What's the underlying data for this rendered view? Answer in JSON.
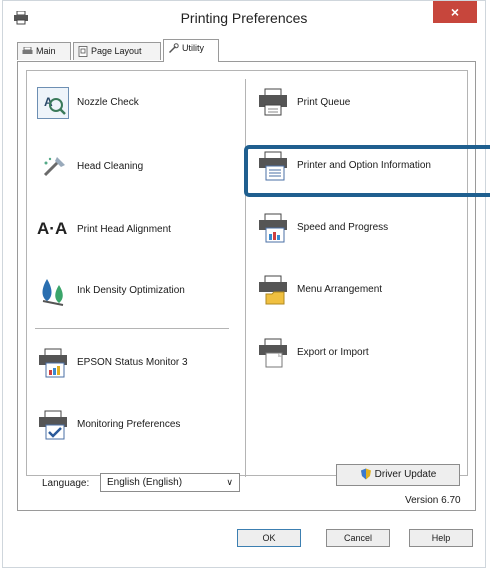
{
  "window": {
    "title": "Printing Preferences",
    "close_glyph": "×"
  },
  "tabs": [
    {
      "label": "Main",
      "icon": "printer-icon"
    },
    {
      "label": "Page Layout",
      "icon": "page-layout-icon"
    },
    {
      "label": "Utility",
      "icon": "wrench-icon",
      "active": true
    }
  ],
  "left_items": [
    {
      "label": "Nozzle Check",
      "icon": "nozzle-check-icon"
    },
    {
      "label": "Head Cleaning",
      "icon": "head-cleaning-icon"
    },
    {
      "label": "Print Head Alignment",
      "icon": "head-alignment-icon",
      "glyph": "A·A"
    },
    {
      "label": "Ink Density Optimization",
      "icon": "ink-density-icon"
    },
    {
      "label": "EPSON Status Monitor 3",
      "icon": "status-monitor-icon"
    },
    {
      "label": "Monitoring Preferences",
      "icon": "monitoring-preferences-icon"
    }
  ],
  "right_items": [
    {
      "label": "Print Queue",
      "icon": "print-queue-icon"
    },
    {
      "label": "Printer and Option Information",
      "icon": "printer-info-icon"
    },
    {
      "label": "Speed and Progress",
      "icon": "speed-progress-icon"
    },
    {
      "label": "Menu Arrangement",
      "icon": "menu-arrangement-icon"
    },
    {
      "label": "Export or Import",
      "icon": "export-import-icon"
    }
  ],
  "language": {
    "label": "Language:",
    "value": "English (English)",
    "chevron": "∨"
  },
  "driver_update": {
    "label": "Driver Update"
  },
  "version": "Version 6.70",
  "buttons": {
    "ok": "OK",
    "cancel": "Cancel",
    "help": "Help"
  },
  "colors": {
    "close": "#c7463c",
    "highlight": "#1f5f8f",
    "accent": "#3c7fb1"
  }
}
